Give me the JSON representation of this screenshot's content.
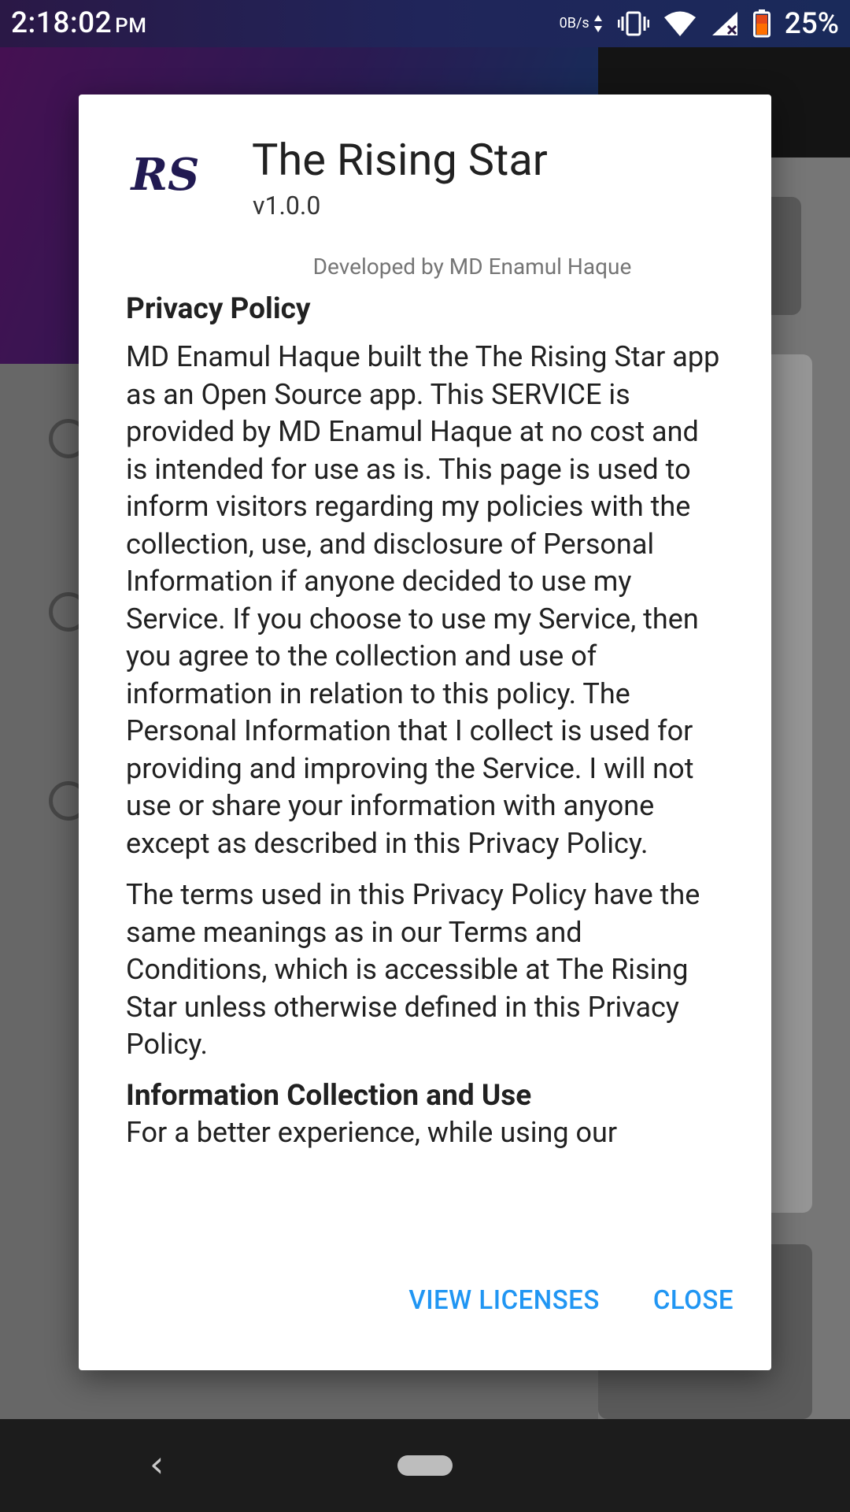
{
  "status_bar": {
    "time": "2:18:02",
    "ampm": "PM",
    "net_speed": "0B/s",
    "battery": "25%"
  },
  "dialog": {
    "logo": "RS",
    "app_name": "The Rising Star",
    "version": "v1.0.0",
    "developer": "Developed by MD Enamul Haque",
    "sections": [
      {
        "heading": "Privacy Policy",
        "paragraphs": [
          "MD Enamul Haque built the The Rising Star app as an Open Source app. This SERVICE is provided by MD Enamul Haque at no cost and is intended for use as is. This page is used to inform visitors regarding my policies with the collection, use, and disclosure of Personal Information if anyone decided to use my Service. If you choose to use my Service, then you agree to the collection and use of information in relation to this policy. The Personal Information that I collect is used for providing and improving the Service. I will not use or share your information with anyone except as described in this Privacy Policy.",
          "The terms used in this Privacy Policy have the same meanings as in our Terms and Conditions, which is accessible at The Rising Star unless otherwise defined in this Privacy Policy."
        ]
      },
      {
        "heading": "Information Collection and Use",
        "paragraphs": [
          "For a better experience, while using our"
        ]
      }
    ],
    "view_licenses_label": "VIEW LICENSES",
    "close_label": "CLOSE"
  },
  "colors": {
    "accent": "#2196f3",
    "logo": "#211a52"
  }
}
